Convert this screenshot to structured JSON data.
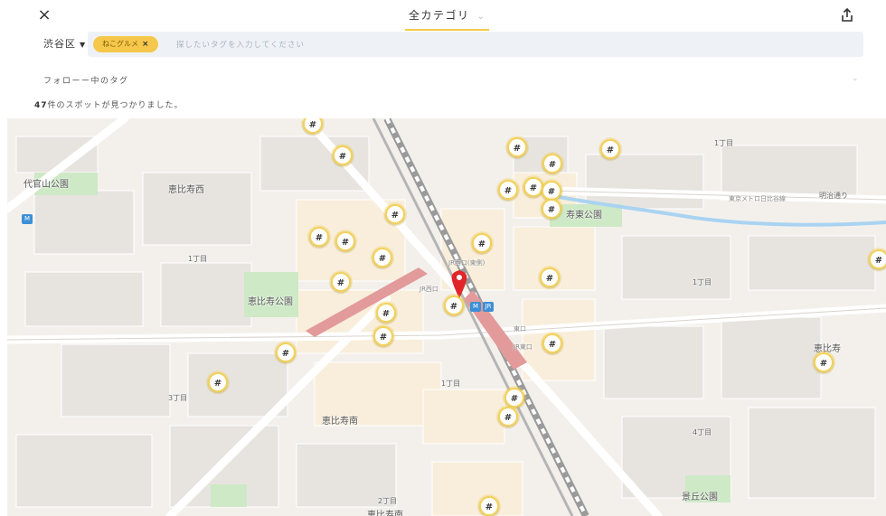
{
  "header": {
    "close_icon": "×",
    "category_label": "全カテゴリ",
    "category_chevron": "⌄",
    "share_icon": "share-icon"
  },
  "search": {
    "area_label": "渋谷区",
    "area_chevron": "▼",
    "chip_label": "ねこグルメ",
    "chip_remove": "×",
    "placeholder": "探したいタグを入力してください",
    "value": ""
  },
  "follow": {
    "label": "フォローー中のタグ",
    "chevron": "⌄"
  },
  "result": {
    "count": "47",
    "text": "件のスポットが見つかりました。"
  },
  "map": {
    "pin_glyph": "#",
    "labels": {
      "daikanyama_park": "代官山公園",
      "ebisu_nishi": "恵比寿西",
      "itchome_1": "1丁目",
      "ebisu_park": "恵比寿公園",
      "itchome_2": "1丁目",
      "itchome_3": "1丁目",
      "itchome_4": "1丁目",
      "sanchome": "3丁目",
      "ebisu_minami": "恵比寿南",
      "nichome": "2丁目",
      "ebisu_bottom": "恵比寿南",
      "higashi_park": "寿東公園",
      "metro_line": "東京メトロ日比谷線",
      "meiji_dori": "明治通り",
      "jr_west_east": "JR西口(東側)",
      "jr_west": "JR西口",
      "east_exit": "東口",
      "jr_east": "JR東口",
      "yonchome": "4丁目",
      "ebisu_right": "恵比寿",
      "kei_park": "景丘公園"
    },
    "metro_badge": "M",
    "jr_badge": "JR"
  }
}
